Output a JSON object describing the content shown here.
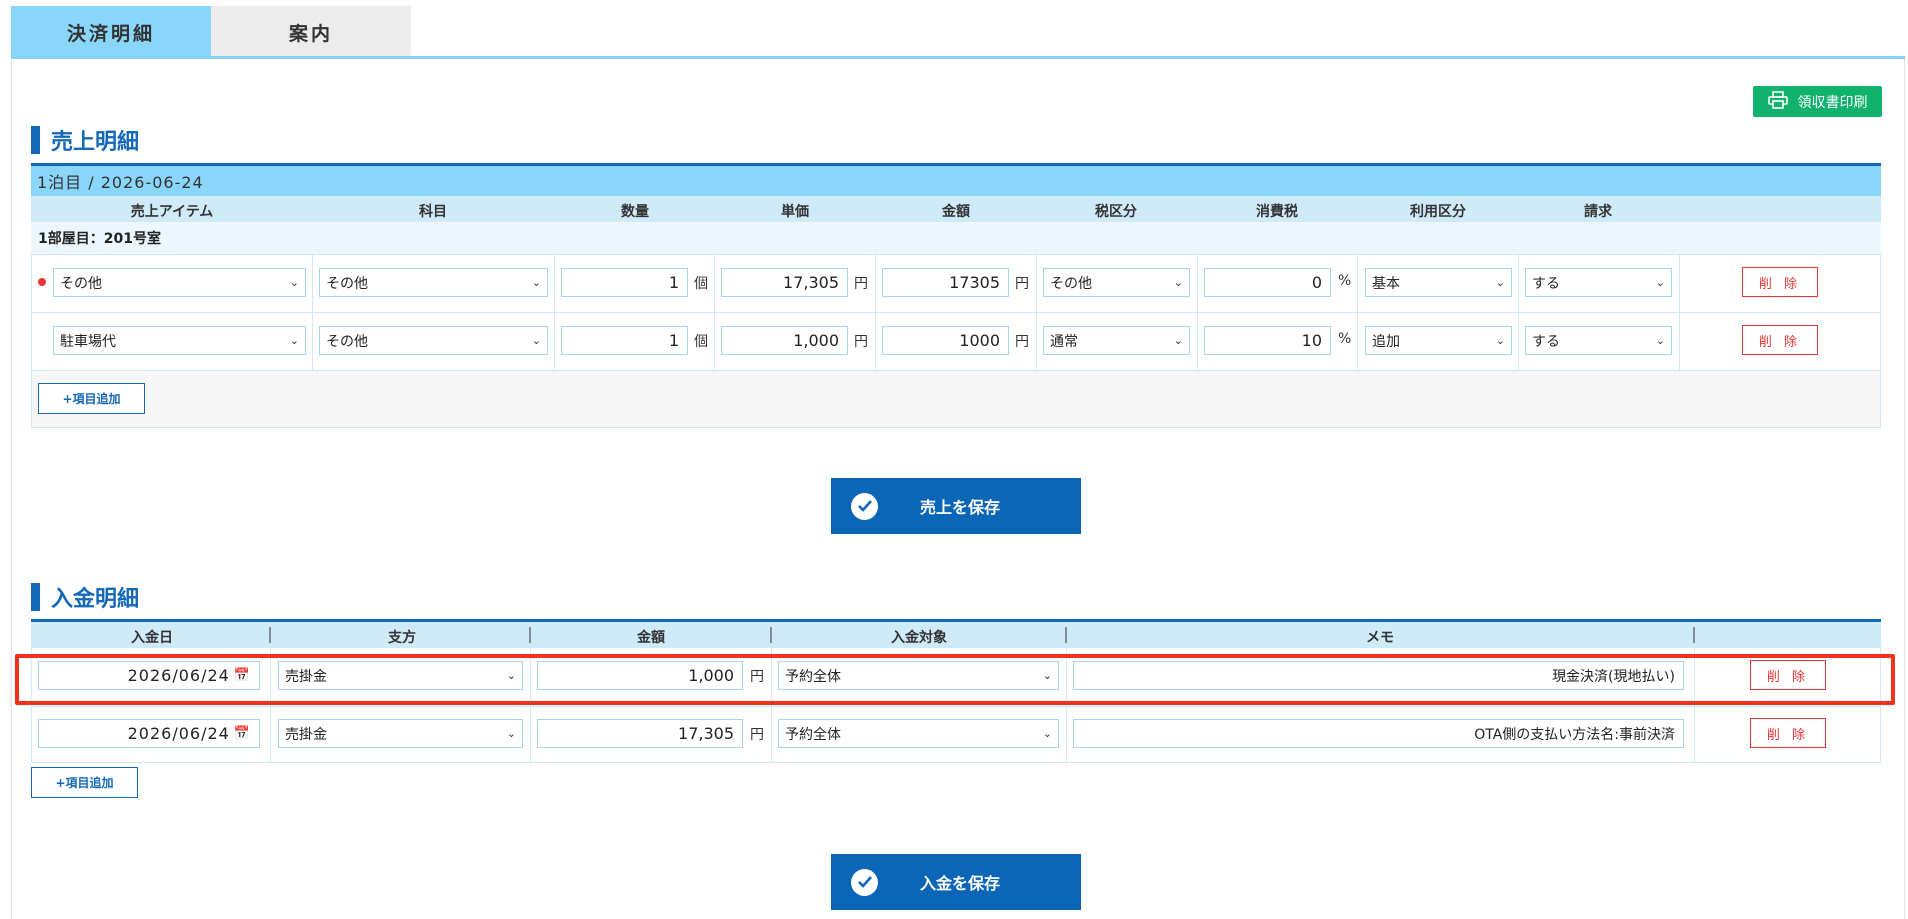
{
  "tabs": {
    "active": "決済明細",
    "inactive": "案内"
  },
  "receipt_button": "領収書印刷",
  "sales": {
    "title": "売上明細",
    "night_label": "1泊目 / 2026-06-24",
    "columns": [
      "売上アイテム",
      "科目",
      "数量",
      "単価",
      "金額",
      "税区分",
      "消費税",
      "利用区分",
      "請求"
    ],
    "room_label": "1部屋目：201号室",
    "rows": [
      {
        "item": "その他",
        "subject": "その他",
        "qty": "1",
        "qty_unit": "個",
        "unit_price": "17,305",
        "price_unit": "円",
        "amount": "17305",
        "amount_unit": "円",
        "tax_type": "その他",
        "tax": "0",
        "tax_unit": "%",
        "usage": "基本",
        "billing": "する",
        "delete": "削 除"
      },
      {
        "item": "駐車場代",
        "subject": "その他",
        "qty": "1",
        "qty_unit": "個",
        "unit_price": "1,000",
        "price_unit": "円",
        "amount": "1000",
        "amount_unit": "円",
        "tax_type": "通常",
        "tax": "10",
        "tax_unit": "%",
        "usage": "追加",
        "billing": "する",
        "delete": "削 除"
      }
    ],
    "add_button": "+項目追加",
    "save_button": "売上を保存"
  },
  "payments": {
    "title": "入金明細",
    "columns": [
      "入金日",
      "支方",
      "金額",
      "入金対象",
      "メモ"
    ],
    "rows": [
      {
        "date": "2026/06/24",
        "method": "売掛金",
        "amount": "1,000",
        "amount_unit": "円",
        "target": "予約全体",
        "memo": "現金決済(現地払い)",
        "delete": "削 除"
      },
      {
        "date": "2026/06/24",
        "method": "売掛金",
        "amount": "17,305",
        "amount_unit": "円",
        "target": "予約全体",
        "memo": "OTA側の支払い方法名:事前決済",
        "delete": "削 除"
      }
    ],
    "add_button": "+項目追加",
    "save_button": "入金を保存"
  },
  "colors": {
    "tab_active": "#8ad6fb",
    "brand_blue": "#1468b8",
    "receipt_green": "#10b26e",
    "delete_red": "#e33333",
    "highlight_red": "#f2321c"
  }
}
